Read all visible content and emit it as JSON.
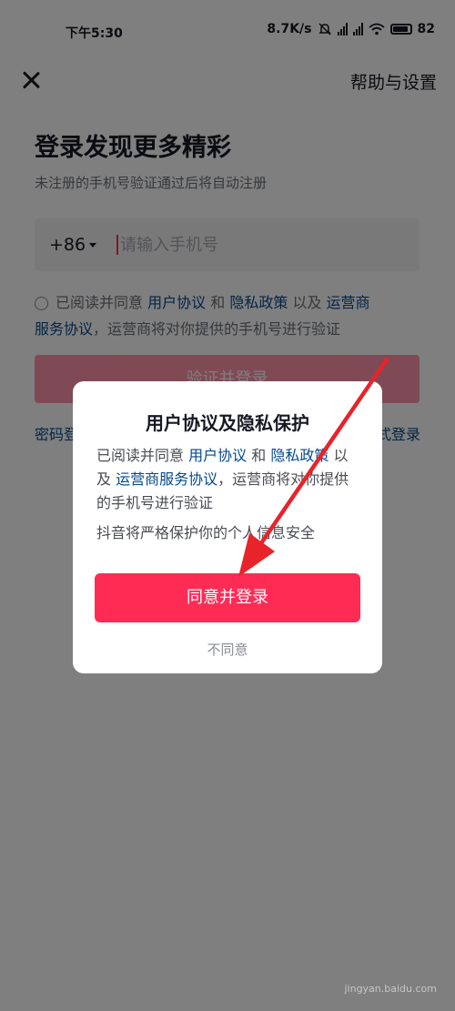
{
  "status_bar": {
    "time": "下午5:30",
    "speed": "8.7K/s",
    "battery": "82"
  },
  "header": {
    "help_label": "帮助与设置"
  },
  "login": {
    "title": "登录发现更多精彩",
    "subtitle": "未注册的手机号验证通过后将自动注册",
    "country_code": "+86",
    "phone_placeholder": "请输入手机号",
    "agree_text_1": "已阅读并同意",
    "user_agreement": "用户协议",
    "and_1": "和",
    "privacy_policy": "隐私政策",
    "and_2": "以及",
    "operator_agreement_line1": "运营商",
    "operator_agreement_line2": "服务协议",
    "agree_text_2": "，运营商将对你提供的手机号进行验证",
    "verify_button": "验证并登录",
    "bottom_left_label": "密码登录",
    "bottom_right_label": "其他方式登录"
  },
  "dialog": {
    "title": "用户协议及隐私保护",
    "body_1": "已阅读并同意",
    "user_agreement": "用户协议",
    "and_1": "和",
    "privacy_policy": "隐私政策",
    "and_2": "以及",
    "operator_agreement": "运营商服务协议",
    "body_2": "，运营商将对你提供的手机号进行验证",
    "note": "抖音将严格保护你的个人信息安全",
    "agree_button": "同意并登录",
    "disagree_button": "不同意"
  },
  "watermark": "jingyan.baidu.com",
  "colors": {
    "accent": "#fe2c55",
    "link": "#04498d",
    "arrow": "#e8232a"
  }
}
